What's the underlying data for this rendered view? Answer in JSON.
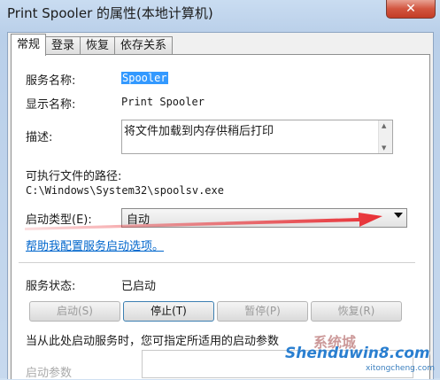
{
  "window": {
    "title": "Print Spooler 的属性(本地计算机)",
    "close_glyph": "✕"
  },
  "tabs": [
    {
      "label": "常规",
      "active": true
    },
    {
      "label": "登录",
      "active": false
    },
    {
      "label": "恢复",
      "active": false
    },
    {
      "label": "依存关系",
      "active": false
    }
  ],
  "general": {
    "service_name_label": "服务名称:",
    "service_name_value": "Spooler",
    "display_name_label": "显示名称:",
    "display_name_value": "Print Spooler",
    "description_label": "描述:",
    "description_value": "将文件加载到内存供稍后打印",
    "exe_path_label": "可执行文件的路径:",
    "exe_path_value": "C:\\Windows\\System32\\spoolsv.exe",
    "startup_type_label": "启动类型(E):",
    "startup_type_value": "自动",
    "help_link": "帮助我配置服务启动选项。",
    "service_status_label": "服务状态:",
    "service_status_value": "已启动",
    "buttons": {
      "start": "启动(S)",
      "stop": "停止(T)",
      "pause": "暂停(P)",
      "resume": "恢复(R)"
    },
    "start_params_note": "当从此处启动服务时，您可指定所适用的启动参数",
    "start_params_label": "启动参数"
  },
  "watermark": {
    "logo": "系统城",
    "main": "Shenduwin8.com",
    "sub": "xitongcheng.com"
  },
  "colors": {
    "accent_selection": "#3399ff",
    "link": "#0066cc",
    "annotation_arrow": "#e8262c"
  }
}
